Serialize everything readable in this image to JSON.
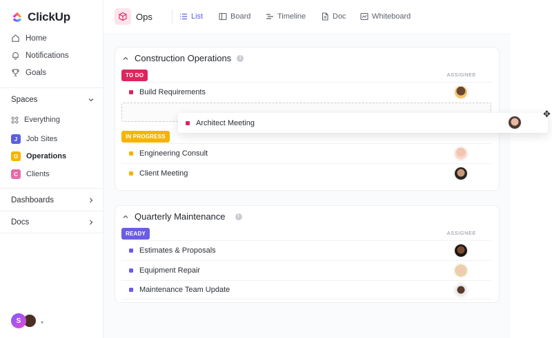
{
  "app": {
    "name": "ClickUp"
  },
  "nav": [
    {
      "label": "Home",
      "icon": "home-icon"
    },
    {
      "label": "Notifications",
      "icon": "bell-icon"
    },
    {
      "label": "Goals",
      "icon": "trophy-icon"
    }
  ],
  "spaces": {
    "header": "Spaces",
    "items": [
      {
        "label": "Everything",
        "badge": "",
        "color": ""
      },
      {
        "label": "Job Sites",
        "badge": "J",
        "color": "#5b5fe0"
      },
      {
        "label": "Operations",
        "badge": "O",
        "color": "#f5b400"
      },
      {
        "label": "Clients",
        "badge": "C",
        "color": "#e86aa8"
      }
    ]
  },
  "sections": [
    {
      "label": "Dashboards"
    },
    {
      "label": "Docs"
    }
  ],
  "user": {
    "initial": "S"
  },
  "topbar": {
    "title": "Ops",
    "tabs": [
      {
        "label": "List",
        "icon": "list-icon",
        "active": true
      },
      {
        "label": "Board",
        "icon": "board-icon",
        "active": false
      },
      {
        "label": "Timeline",
        "icon": "timeline-icon",
        "active": false
      },
      {
        "label": "Doc",
        "icon": "doc-icon",
        "active": false
      },
      {
        "label": "Whiteboard",
        "icon": "whiteboard-icon",
        "active": false
      }
    ]
  },
  "lists": [
    {
      "title": "Construction Operations",
      "groups": [
        {
          "status": "TO DO",
          "color": "#e0245e",
          "assignee_header": "ASSIGNEE",
          "tasks": [
            {
              "name": "Build Requirements",
              "dot": "#e0245e"
            }
          ]
        },
        {
          "status": "IN PROGRESS",
          "color": "#f5b400",
          "tasks": [
            {
              "name": "Engineering Consult",
              "dot": "#f5b400"
            },
            {
              "name": "Client Meeting",
              "dot": "#f5b400"
            }
          ]
        }
      ]
    },
    {
      "title": "Quarterly Maintenance",
      "groups": [
        {
          "status": "READY",
          "color": "#6b5ce7",
          "assignee_header": "ASSIGNEE",
          "tasks": [
            {
              "name": "Estimates & Proposals",
              "dot": "#6b5ce7"
            },
            {
              "name": "Equipment Repair",
              "dot": "#6b5ce7"
            },
            {
              "name": "Maintenance Team Update",
              "dot": "#6b5ce7"
            }
          ]
        }
      ]
    }
  ],
  "dragging": {
    "name": "Architect Meeting",
    "dot": "#e0245e"
  }
}
